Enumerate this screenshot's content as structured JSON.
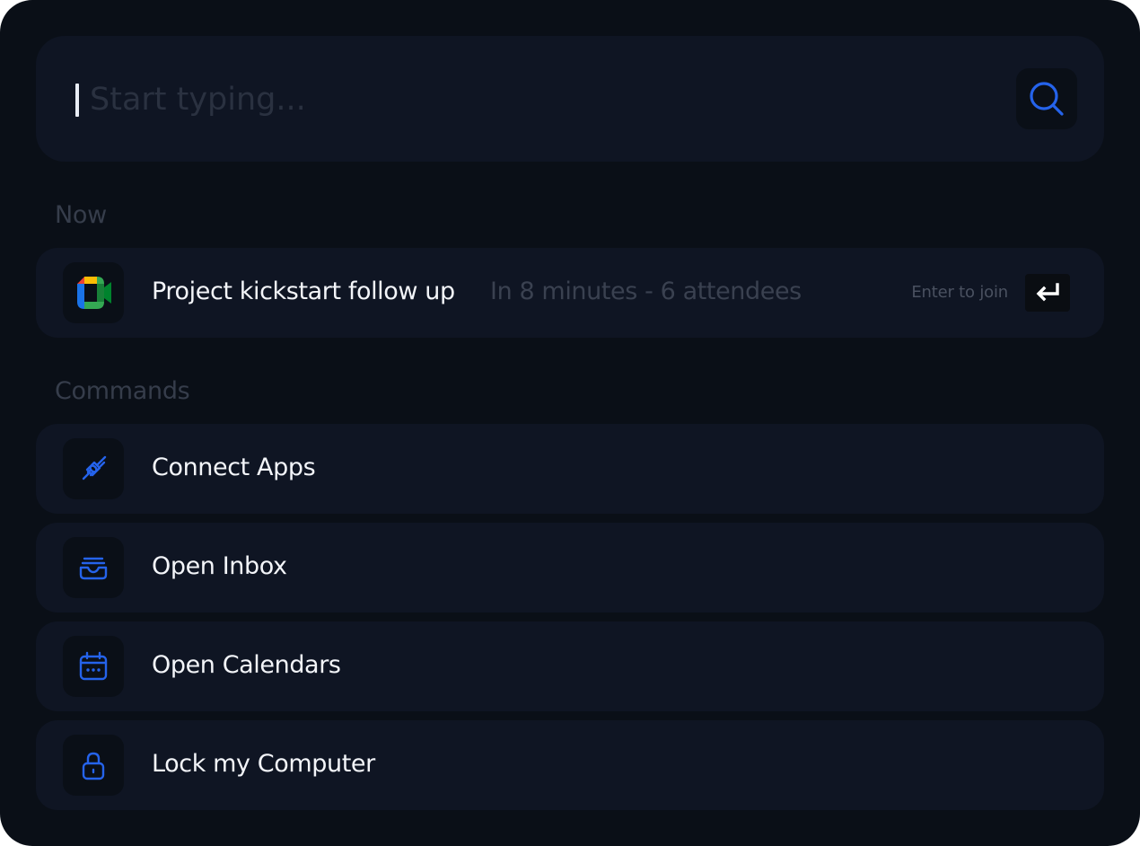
{
  "search": {
    "placeholder": "Start typing...",
    "value": "",
    "button_icon": "search-icon"
  },
  "sections": {
    "now_label": "Now",
    "commands_label": "Commands"
  },
  "now_item": {
    "icon": "google-meet-icon",
    "title": "Project kickstart follow up",
    "meta": "In 8 minutes - 6 attendees",
    "hint": "Enter to join",
    "key_icon": "enter-key-icon"
  },
  "commands": [
    {
      "icon": "plug-icon",
      "label": "Connect Apps"
    },
    {
      "icon": "inbox-icon",
      "label": "Open Inbox"
    },
    {
      "icon": "calendar-icon",
      "label": "Open Calendars"
    },
    {
      "icon": "lock-icon",
      "label": "Lock my Computer"
    }
  ],
  "colors": {
    "background": "#0a0f17",
    "surface": "#0f1523",
    "accent": "#2563eb",
    "text": "#f3f5f9",
    "muted": "#3a4150"
  }
}
